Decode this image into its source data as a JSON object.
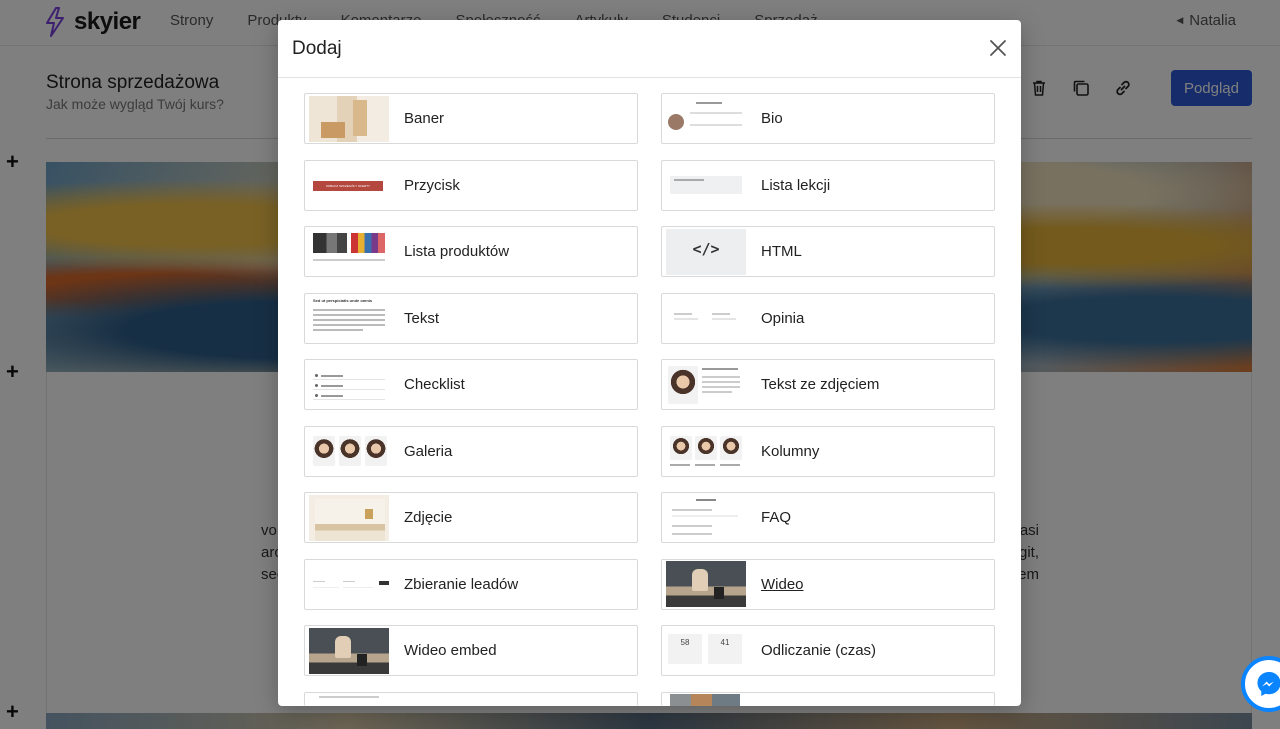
{
  "app": {
    "logo_text": "skyier",
    "nav": [
      "Strony",
      "Produkty",
      "Komentarze",
      "Społeczność",
      "Artykuły",
      "Studenci",
      "Sprzedaż"
    ],
    "user_name": "Natalia"
  },
  "page": {
    "title": "Strona sprzedażowa",
    "subtitle": "Jak może wygląd Twój kurs?",
    "preview_label": "Podgląd",
    "content_lines": [
      [
        "vo",
        "asi"
      ],
      [
        "arc",
        "git,"
      ],
      [
        "sec",
        "em"
      ]
    ]
  },
  "modal": {
    "title": "Dodaj",
    "close_icon": "close-icon",
    "tiles": [
      {
        "label": "Baner",
        "thumb": "banner-thumbnail"
      },
      {
        "label": "Bio",
        "thumb": "bio-thumbnail"
      },
      {
        "label": "Przycisk",
        "thumb": "button-thumbnail",
        "thumb_text": "ZOBACZ SZCZEGÓŁY OFERTY"
      },
      {
        "label": "Lista lekcji",
        "thumb": "lesson-list-thumbnail"
      },
      {
        "label": "Lista produktów",
        "thumb": "product-list-thumbnail"
      },
      {
        "label": "HTML",
        "thumb": "code-icon",
        "thumb_text": "</>"
      },
      {
        "label": "Tekst",
        "thumb": "text-thumbnail",
        "thumb_text": "Sed ut perspiciatis unde omnis"
      },
      {
        "label": "Opinia",
        "thumb": "testimonial-thumbnail"
      },
      {
        "label": "Checklist",
        "thumb": "checklist-thumbnail"
      },
      {
        "label": "Tekst ze zdjęciem",
        "thumb": "text-with-photo-thumbnail"
      },
      {
        "label": "Galeria",
        "thumb": "gallery-thumbnail"
      },
      {
        "label": "Kolumny",
        "thumb": "columns-thumbnail"
      },
      {
        "label": "Zdjęcie",
        "thumb": "photo-thumbnail"
      },
      {
        "label": "FAQ",
        "thumb": "faq-thumbnail"
      },
      {
        "label": "Zbieranie leadów",
        "thumb": "lead-form-thumbnail"
      },
      {
        "label": "Wideo",
        "thumb": "video-thumbnail",
        "hovered": true
      },
      {
        "label": "Wideo embed",
        "thumb": "video-embed-thumbnail"
      },
      {
        "label": "Odliczanie (czas)",
        "thumb": "countdown-thumbnail",
        "thumb_text": [
          "58",
          "41"
        ]
      }
    ]
  },
  "colors": {
    "primary": "#2f5bd7",
    "brand_bolt": "#7a3fe0",
    "overlay": "rgba(0,0,0,0.5)",
    "messenger": "#0a84ff"
  }
}
